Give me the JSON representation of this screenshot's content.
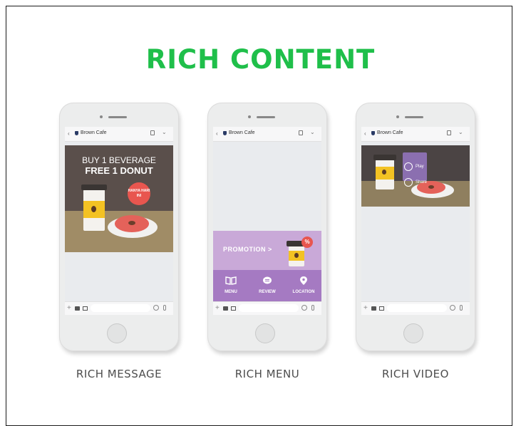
{
  "title": "RICH CONTENT",
  "chat": {
    "name": "Brown Cafe",
    "back": "‹",
    "chevron": "⌄",
    "plus": "+"
  },
  "phones": [
    {
      "caption": "RICH MESSAGE"
    },
    {
      "caption": "RICH MENU"
    },
    {
      "caption": "RICH VIDEO"
    }
  ],
  "rich_message": {
    "line1": "BUY 1 BEVERAGE",
    "line2": "FREE 1 DONUT",
    "badge": "HANYA HARI INI"
  },
  "rich_menu": {
    "promotion": "PROMOTION >",
    "percent": "%",
    "items": [
      "MENU",
      "REVIEW",
      "LOCATION"
    ]
  },
  "rich_video": {
    "play": "Play",
    "share": "Share"
  },
  "colors": {
    "title": "#1fbf4a",
    "promo": "#c9a9d8",
    "menubar": "#a57ac2",
    "badge": "#e8564f",
    "cup_sleeve": "#f3c223"
  }
}
